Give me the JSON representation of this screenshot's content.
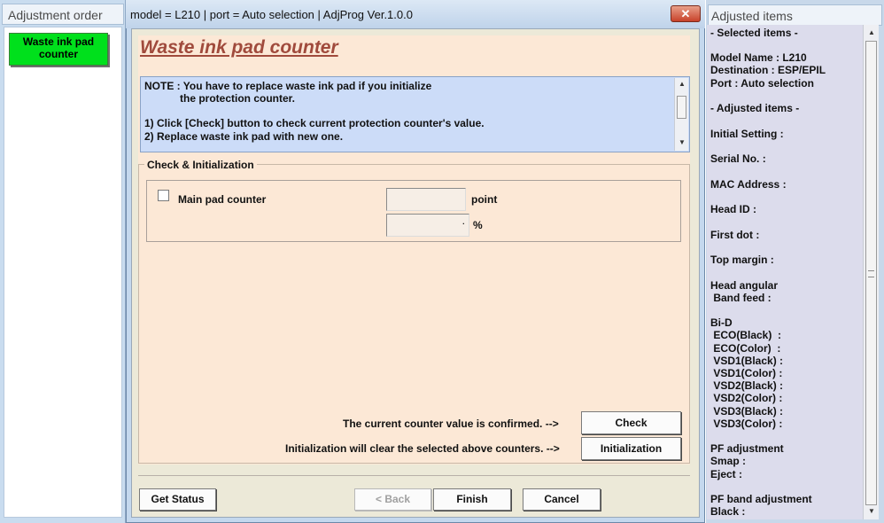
{
  "left_panel": {
    "title": "Adjustment order",
    "items": [
      {
        "label": "Waste ink pad\ncounter"
      }
    ]
  },
  "window": {
    "title": "model = L210 | port = Auto selection | AdjProg Ver.1.0.0",
    "close_glyph": "✕"
  },
  "main": {
    "heading": "Waste ink pad counter",
    "note_lines": [
      "NOTE : You have to replace waste ink pad if you initialize",
      "            the protection counter.",
      "",
      "1) Click [Check] button to check current protection counter's value.",
      "2) Replace waste ink pad with new one."
    ],
    "group_label": "Check & Initialization",
    "counter_label": "Main pad counter",
    "point_value": "",
    "point_unit": "point",
    "percent_value": ".",
    "percent_unit": "%",
    "confirm_text": "The current counter value is confirmed. -->",
    "check_label": "Check",
    "init_text": "Initialization will clear the selected above counters. -->",
    "init_label": "Initialization"
  },
  "footer": {
    "get_status": "Get Status",
    "back": "< Back",
    "finish": "Finish",
    "cancel": "Cancel"
  },
  "right_panel": {
    "title": "Adjusted items",
    "lines": [
      "- Selected items -",
      "Model Name : L210",
      "Destination : ESP/EPIL",
      "Port : Auto selection",
      "- Adjusted items -",
      "Initial Setting :",
      "Serial No. :",
      "MAC Address :",
      "Head ID :",
      "First dot :",
      "Top margin :",
      "Head angular",
      " Band feed :",
      "Bi-D",
      " ECO(Black)  :",
      " ECO(Color)  :",
      " VSD1(Black) :",
      " VSD1(Color) :",
      " VSD2(Black) :",
      " VSD2(Color) :",
      " VSD3(Black) :",
      " VSD3(Color) :",
      "PF adjustment",
      "Smap :",
      "Eject :",
      "PF band adjustment",
      "Black :"
    ]
  },
  "colors": {
    "accent_green": "#00e01c",
    "heading_red": "#a04a3c",
    "note_blue": "#ccdcf8",
    "panel_peach": "#fce8d6"
  },
  "icons": [
    "close-icon",
    "scroll-up-icon",
    "scroll-down-icon",
    "scroll-thumb-icon"
  ]
}
